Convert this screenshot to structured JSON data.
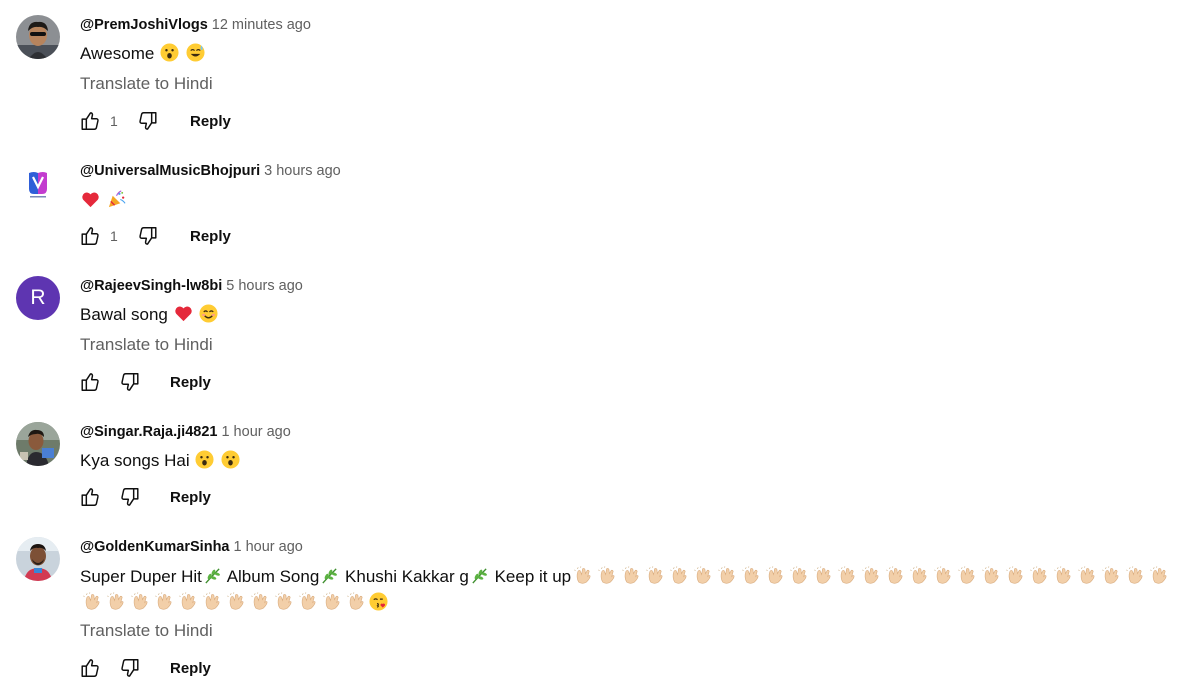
{
  "comments": [
    {
      "author": "@PremJoshiVlogs",
      "time": "12 minutes ago",
      "text": "Awesome",
      "emojis": [
        "astonished",
        "sweat-smile"
      ],
      "translate": "Translate to Hindi",
      "likes": "1",
      "reply": "Reply",
      "avatar": "photo"
    },
    {
      "author": "@UniversalMusicBhojpuri",
      "time": "3 hours ago",
      "text": "",
      "emojis": [
        "red-heart",
        "party-popper"
      ],
      "likes": "1",
      "reply": "Reply",
      "avatar": "logo"
    },
    {
      "author": "@RajeevSingh-lw8bi",
      "time": "5 hours ago",
      "text": "Bawal song",
      "emojis": [
        "red-heart",
        "smiling-face"
      ],
      "translate": "Translate to Hindi",
      "likes": "",
      "reply": "Reply",
      "avatar_letter": "R",
      "avatar_color": "#5e35b1"
    },
    {
      "author": "@Singar.Raja.ji4821",
      "time": "1 hour ago",
      "text": "Kya songs Hai",
      "emojis": [
        "astonished",
        "astonished"
      ],
      "likes": "",
      "reply": "Reply",
      "avatar": "photo"
    },
    {
      "author": "@GoldenKumarSinha",
      "time": "1 hour ago",
      "segments": [
        "Super Duper Hit",
        "Album Song",
        "Khushi Kakkar g",
        "Keep it up"
      ],
      "emojis_line1": "herb x3, clapping-hands x25",
      "emojis_line2": "clapping-hands x12, face-blowing-kiss",
      "translate": "Translate to Hindi",
      "likes": "",
      "reply": "Reply",
      "avatar": "photo"
    }
  ],
  "icons": {
    "like": "thumbs-up-icon",
    "dislike": "thumbs-down-icon"
  },
  "colors": {
    "secondary_text": "#606060",
    "primary_text": "#0f0f0f"
  }
}
